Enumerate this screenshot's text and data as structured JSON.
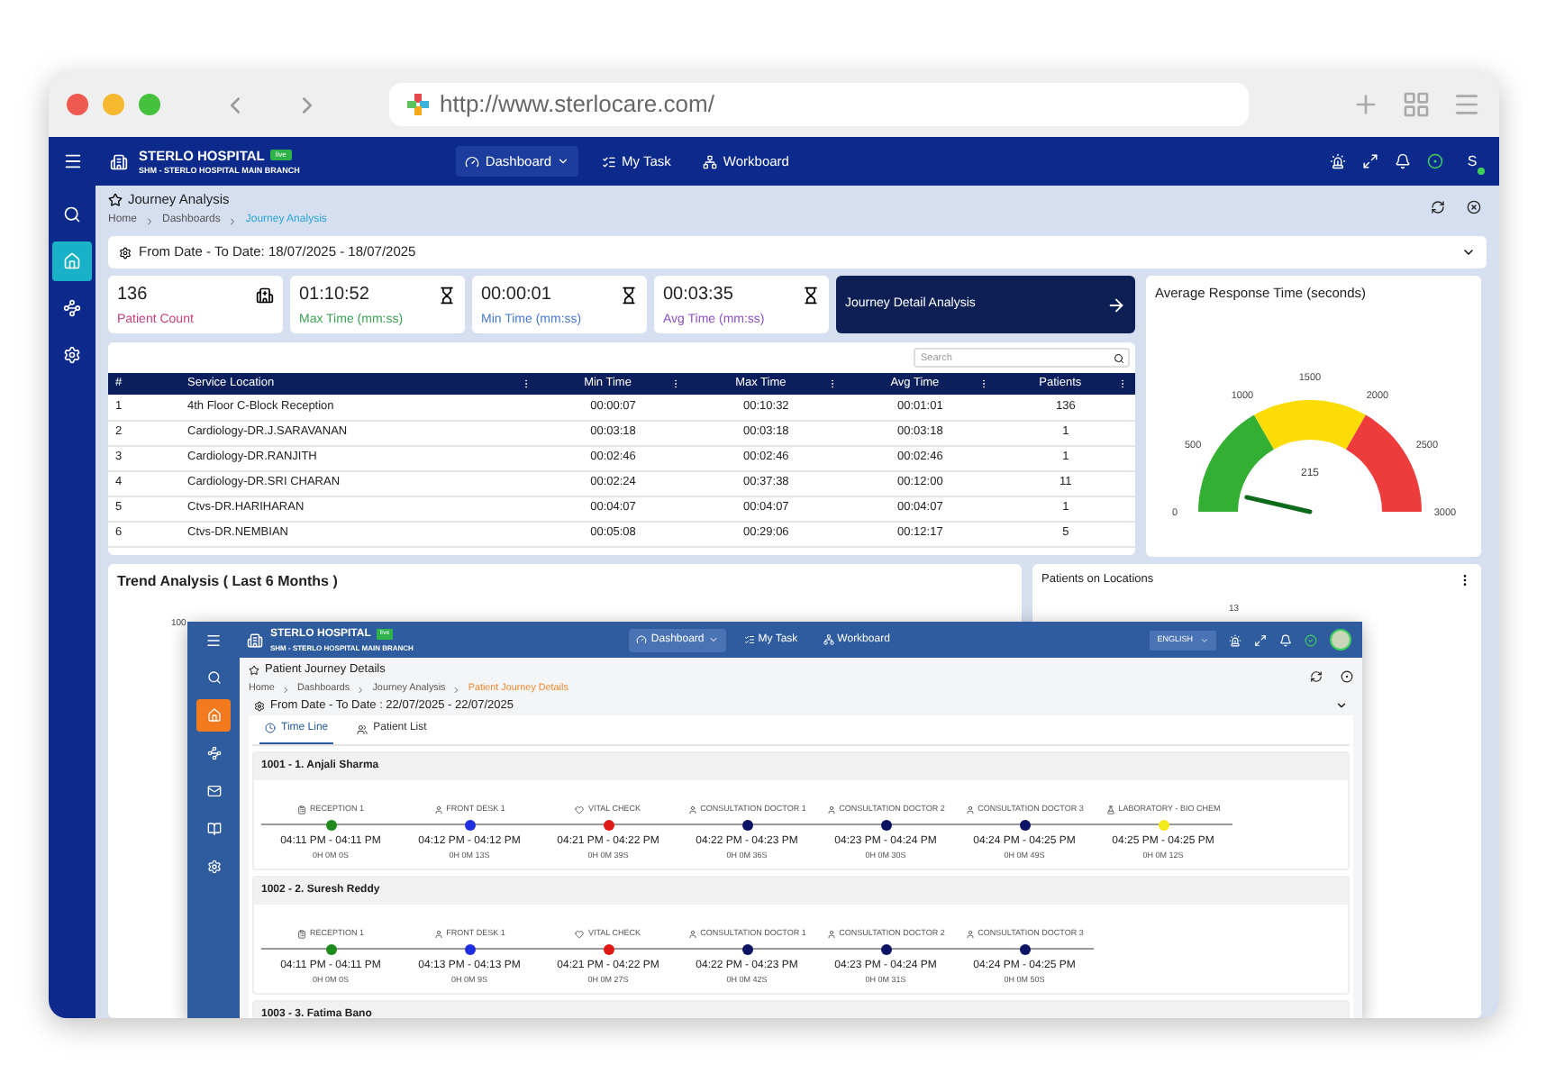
{
  "browser": {
    "url": "http://www.sterlocare.com/"
  },
  "app": {
    "hospital": "STERLO HOSPITAL",
    "badge": "live",
    "branch": "SHM - STERLO HOSPITAL MAIN BRANCH",
    "avatar": "S",
    "nav": [
      {
        "label": "Dashboard",
        "kind": "dashboard",
        "selected": true
      },
      {
        "label": "My Task",
        "kind": "task",
        "selected": false
      },
      {
        "label": "Workboard",
        "kind": "workboard",
        "selected": false
      }
    ]
  },
  "sidebar": [
    {
      "kind": "search",
      "selected": false
    },
    {
      "kind": "home",
      "selected": true
    },
    {
      "kind": "route",
      "selected": false
    },
    {
      "kind": "settings",
      "selected": false
    }
  ],
  "page": {
    "title": "Journey Analysis",
    "breadcrumb": [
      {
        "label": "Home",
        "selected": false
      },
      {
        "label": "Dashboards",
        "selected": false
      },
      {
        "label": "Journey Analysis",
        "selected": true
      }
    ]
  },
  "filter": {
    "label": "From Date - To Date: 18/07/2025 - 18/07/2025"
  },
  "stats": [
    {
      "value": "136",
      "label": "Patient Count",
      "color": "#c2417e",
      "kind": "hospital"
    },
    {
      "value": "01:10:52",
      "label": "Max Time (mm:ss)",
      "color": "#3c9f52",
      "kind": "hourglass"
    },
    {
      "value": "00:00:01",
      "label": "Min Time (mm:ss)",
      "color": "#4a78cc",
      "kind": "hourglass"
    },
    {
      "value": "00:03:35",
      "label": "Avg Time (mm:ss)",
      "color": "#8d52c4",
      "kind": "hourglass"
    }
  ],
  "journey_button": {
    "label": "Journey Detail Analysis"
  },
  "table": {
    "search_placeholder": "Search",
    "columns": [
      "#",
      "Service Location",
      "Min Time",
      "Max Time",
      "Avg Time",
      "Patients"
    ],
    "rows": [
      [
        "1",
        "4th Floor C-Block Reception",
        "00:00:07",
        "00:10:32",
        "00:01:01",
        "136"
      ],
      [
        "2",
        "Cardiology-DR.J.SARAVANAN",
        "00:03:18",
        "00:03:18",
        "00:03:18",
        "1"
      ],
      [
        "3",
        "Cardiology-DR.RANJITH",
        "00:02:46",
        "00:02:46",
        "00:02:46",
        "1"
      ],
      [
        "4",
        "Cardiology-DR.SRI CHARAN",
        "00:02:24",
        "00:37:38",
        "00:12:00",
        "11"
      ],
      [
        "5",
        "Ctvs-DR.HARIHARAN",
        "00:04:07",
        "00:04:07",
        "00:04:07",
        "1"
      ],
      [
        "6",
        "Ctvs-DR.NEMBIAN",
        "00:05:08",
        "00:29:06",
        "00:12:17",
        "5"
      ]
    ]
  },
  "gauge": {
    "title": "Average Response Time (seconds)",
    "ticks": [
      "0",
      "500",
      "1000",
      "1500",
      "2000",
      "2500",
      "3000"
    ],
    "reading": "215",
    "level": 0.0717
  },
  "trend": {
    "title": "Trend Analysis ( Last 6 Months )",
    "axis_label": "100"
  },
  "locations": {
    "title": "Patients on Locations",
    "value_label": "13"
  },
  "overlay": {
    "hospital": "STERLO HOSPITAL",
    "badge": "live",
    "branch": "SHM - STERLO HOSPITAL MAIN BRANCH",
    "language": "ENGLISH",
    "nav": [
      {
        "label": "Dashboard",
        "kind": "dashboard",
        "selected": true
      },
      {
        "label": "My Task",
        "kind": "task",
        "selected": false
      },
      {
        "label": "Workboard",
        "kind": "workboard",
        "selected": false
      }
    ],
    "sidebar": [
      {
        "kind": "search",
        "selected": false
      },
      {
        "kind": "home",
        "selected": true
      },
      {
        "kind": "route",
        "selected": false
      },
      {
        "kind": "mail",
        "selected": false
      },
      {
        "kind": "book",
        "selected": false
      },
      {
        "kind": "settings",
        "selected": false
      }
    ],
    "title": "Patient Journey Details",
    "breadcrumb": [
      {
        "label": "Home",
        "selected": false
      },
      {
        "label": "Dashboards",
        "selected": false
      },
      {
        "label": "Journey Analysis",
        "selected": false
      },
      {
        "label": "Patient Journey Details",
        "selected": true
      }
    ],
    "filter": "From Date - To Date : 22/07/2025 - 22/07/2025",
    "tabs": [
      {
        "label": "Time Line",
        "kind": "clock",
        "selected": true
      },
      {
        "label": "Patient List",
        "kind": "list",
        "selected": false
      }
    ],
    "patients": [
      {
        "title": "1001 - 1. Anjali Sharma",
        "stations": [
          {
            "label": "RECEPTION 1",
            "kind": "reception",
            "color": "#1e8a1e",
            "time": "04:11 PM - 04:11 PM",
            "duration": "0H 0M 0S"
          },
          {
            "label": "FRONT DESK 1",
            "kind": "person",
            "color": "#1f2fe0",
            "time": "04:12 PM - 04:12 PM",
            "duration": "0H 0M 13S"
          },
          {
            "label": "VITAL CHECK",
            "kind": "vital",
            "color": "#e01818",
            "time": "04:21 PM - 04:22 PM",
            "duration": "0H 0M 39S"
          },
          {
            "label": "CONSULTATION DOCTOR 1",
            "kind": "person",
            "color": "#0d1466",
            "time": "04:22 PM - 04:23 PM",
            "duration": "0H 0M 36S"
          },
          {
            "label": "CONSULTATION DOCTOR 2",
            "kind": "person",
            "color": "#0d1466",
            "time": "04:23 PM - 04:24 PM",
            "duration": "0H 0M 30S"
          },
          {
            "label": "CONSULTATION DOCTOR 3",
            "kind": "person",
            "color": "#0d1466",
            "time": "04:24 PM - 04:25 PM",
            "duration": "0H 0M 49S"
          },
          {
            "label": "LABORATORY - BIO CHEM",
            "kind": "lab",
            "color": "#f2ea1a",
            "time": "04:25 PM - 04:25 PM",
            "duration": "0H 0M 12S"
          }
        ]
      },
      {
        "title": "1002 - 2. Suresh Reddy",
        "stations": [
          {
            "label": "RECEPTION 1",
            "kind": "reception",
            "color": "#1e8a1e",
            "time": "04:11 PM - 04:11 PM",
            "duration": "0H 0M 0S"
          },
          {
            "label": "FRONT DESK 1",
            "kind": "person",
            "color": "#1f2fe0",
            "time": "04:13 PM - 04:13 PM",
            "duration": "0H 0M 9S"
          },
          {
            "label": "VITAL CHECK",
            "kind": "vital",
            "color": "#e01818",
            "time": "04:21 PM - 04:22 PM",
            "duration": "0H 0M 27S"
          },
          {
            "label": "CONSULTATION DOCTOR 1",
            "kind": "person",
            "color": "#0d1466",
            "time": "04:22 PM - 04:23 PM",
            "duration": "0H 0M 42S"
          },
          {
            "label": "CONSULTATION DOCTOR 2",
            "kind": "person",
            "color": "#0d1466",
            "time": "04:23 PM - 04:24 PM",
            "duration": "0H 0M 31S"
          },
          {
            "label": "CONSULTATION DOCTOR 3",
            "kind": "person",
            "color": "#0d1466",
            "time": "04:24 PM - 04:25 PM",
            "duration": "0H 0M 50S"
          }
        ]
      },
      {
        "title": "1003 - 3. Fatima Bano"
      }
    ]
  }
}
